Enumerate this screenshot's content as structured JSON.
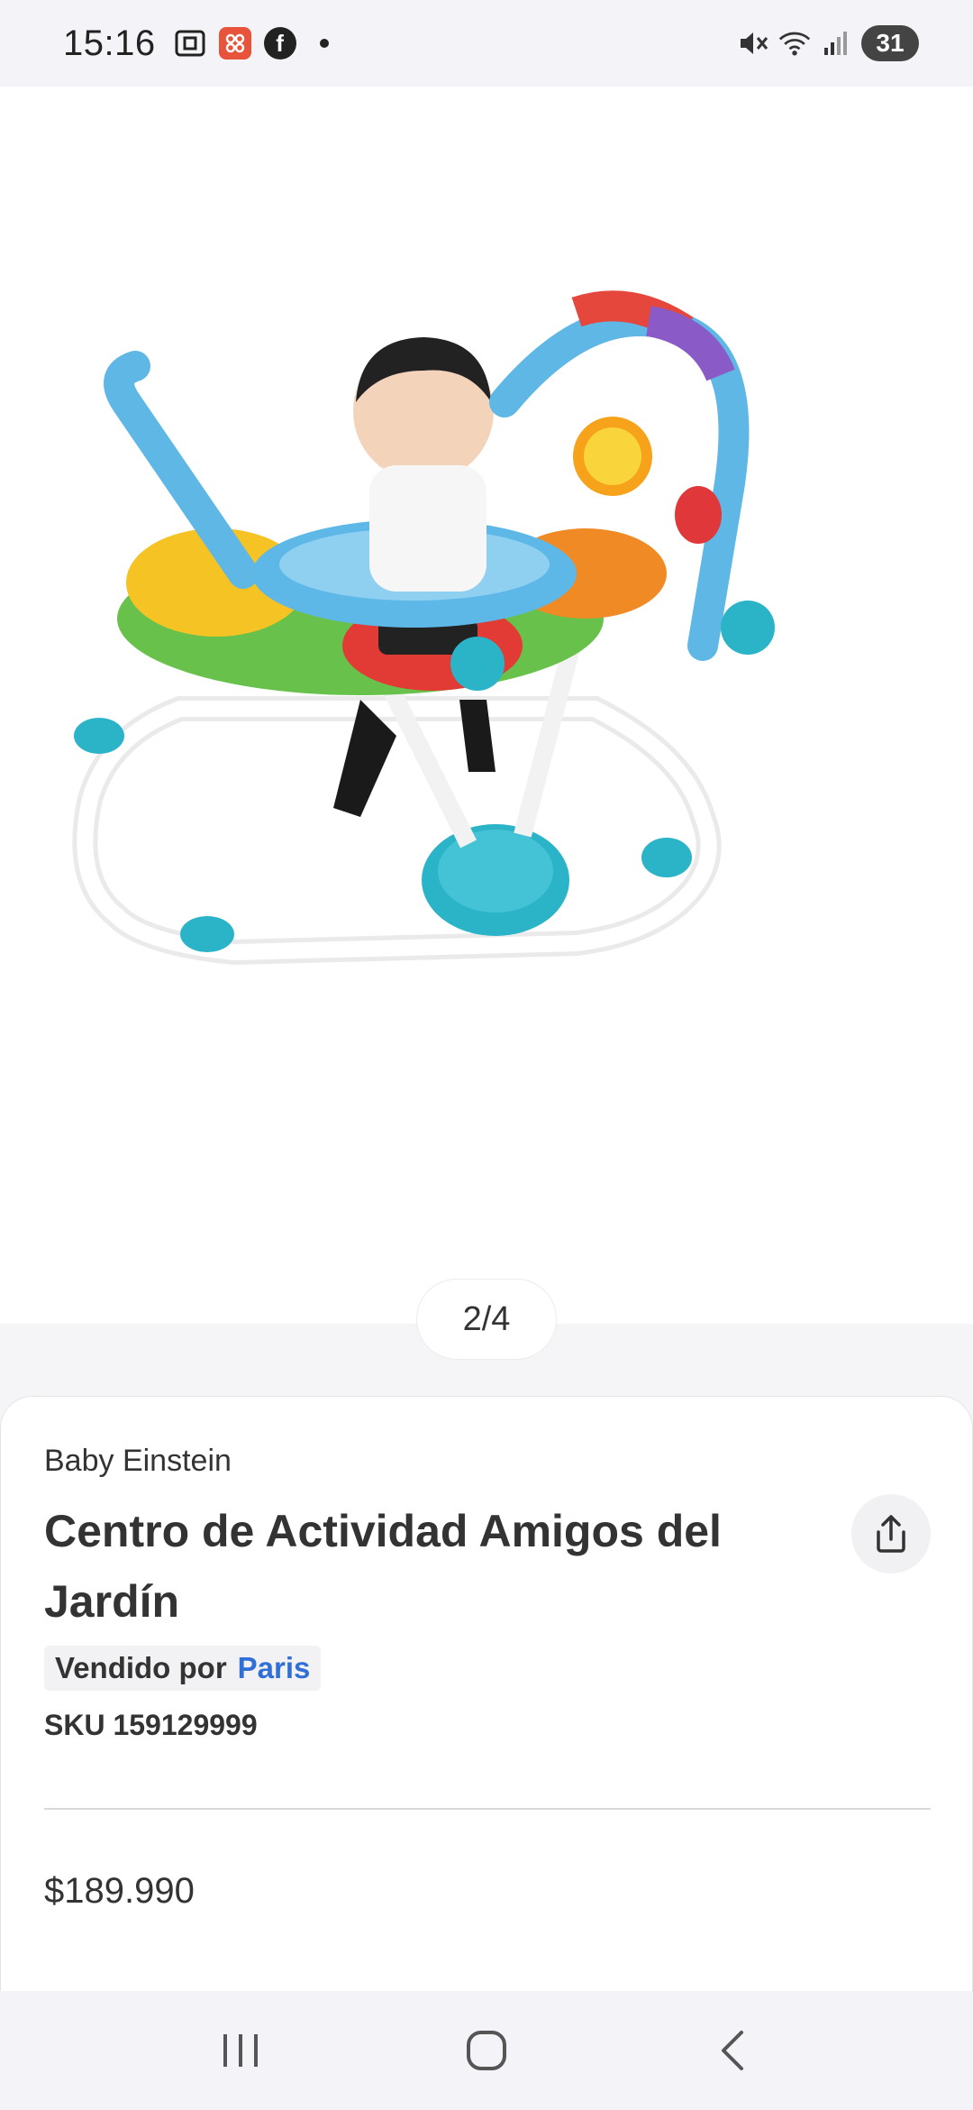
{
  "status_bar": {
    "time": "15:16",
    "icons_left": [
      "screenshot-icon",
      "app-grid-icon",
      "facebook-icon",
      "notification-dot"
    ],
    "icons_right": [
      "mute-icon",
      "wifi-icon",
      "signal-icon"
    ],
    "battery": "31"
  },
  "gallery": {
    "pager": "2/4"
  },
  "product": {
    "brand": "Baby Einstein",
    "title": "Centro de Actividad Amigos del Jardín",
    "seller_label": "Vendido por",
    "seller_name": "Paris",
    "sku": "SKU 159129999",
    "price": "$189.990"
  },
  "nav": {
    "buttons": [
      "recent-apps",
      "home",
      "back"
    ]
  },
  "colors": {
    "accent_link": "#2f6fd6",
    "bar_bg": "#f4f4f8"
  }
}
